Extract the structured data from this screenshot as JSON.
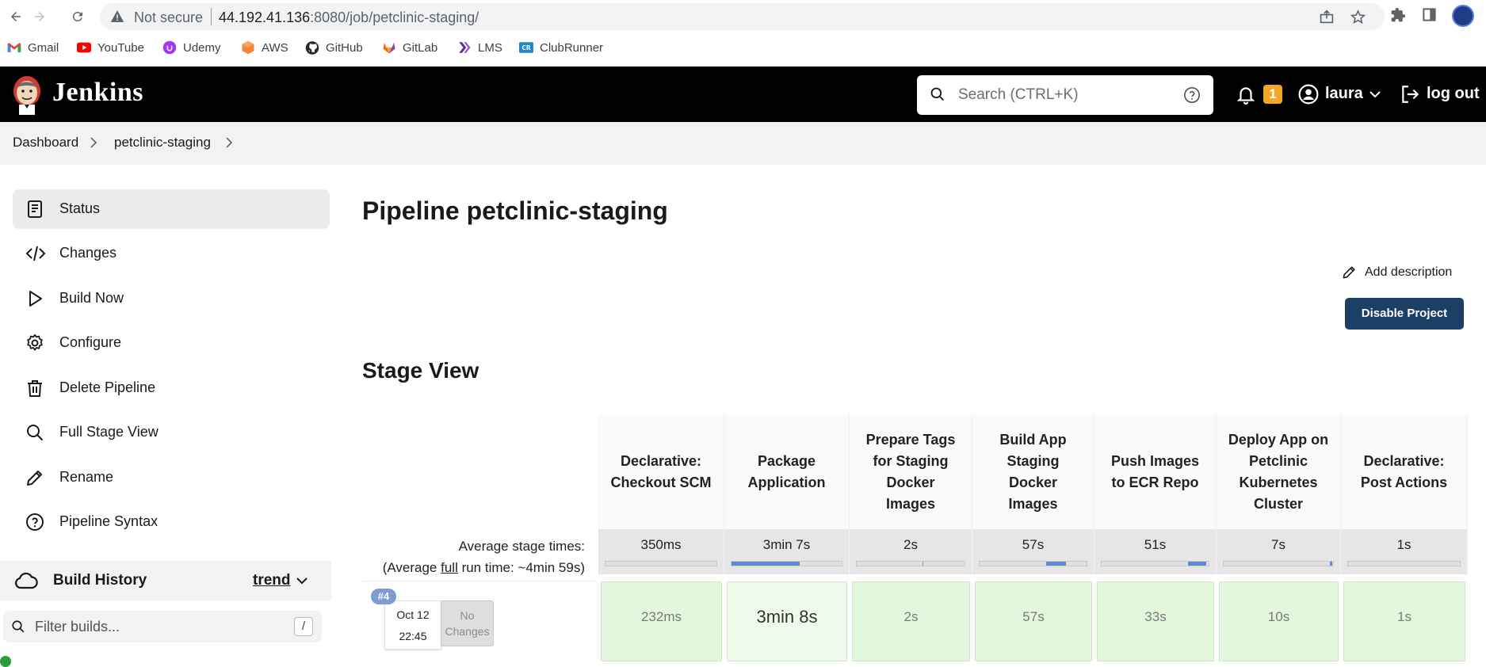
{
  "browser": {
    "security_text": "Not secure",
    "url_host": "44.192.41.136",
    "url_rest": ":8080/job/petclinic-staging/",
    "bookmarks": [
      {
        "label": "Gmail",
        "icon": "gmail-icon"
      },
      {
        "label": "YouTube",
        "icon": "youtube-icon"
      },
      {
        "label": "Udemy",
        "icon": "udemy-icon"
      },
      {
        "label": "AWS",
        "icon": "aws-icon"
      },
      {
        "label": "GitHub",
        "icon": "github-icon"
      },
      {
        "label": "GitLab",
        "icon": "gitlab-icon"
      },
      {
        "label": "LMS",
        "icon": "lms-icon"
      },
      {
        "label": "ClubRunner",
        "icon": "clubrunner-icon"
      }
    ]
  },
  "header": {
    "title": "Jenkins",
    "search_placeholder": "Search (CTRL+K)",
    "notification_count": "1",
    "user": "laura",
    "logout": "log out"
  },
  "breadcrumb": {
    "items": [
      "Dashboard",
      "petclinic-staging"
    ]
  },
  "sidebar": {
    "items": [
      {
        "label": "Status",
        "icon": "status-icon"
      },
      {
        "label": "Changes",
        "icon": "code-icon"
      },
      {
        "label": "Build Now",
        "icon": "play-icon"
      },
      {
        "label": "Configure",
        "icon": "gear-icon"
      },
      {
        "label": "Delete Pipeline",
        "icon": "trash-icon"
      },
      {
        "label": "Full Stage View",
        "icon": "search-icon"
      },
      {
        "label": "Rename",
        "icon": "pencil-icon"
      },
      {
        "label": "Pipeline Syntax",
        "icon": "help-icon"
      }
    ],
    "build_history": {
      "title": "Build History",
      "trend": "trend",
      "filter_placeholder": "Filter builds...",
      "filter_shortcut": "/"
    }
  },
  "main": {
    "title": "Pipeline petclinic-staging",
    "add_description": "Add description",
    "disable_button": "Disable Project",
    "stage_view_title": "Stage View",
    "avg_label_line1": "Average stage times:",
    "avg_label_line2_pre": "(Average ",
    "avg_label_line2_u": "full",
    "avg_label_line2_post": " run time: ~4min 59s)",
    "stages": [
      {
        "name": "Declarative: Checkout SCM",
        "avg": "350ms",
        "result": "232ms"
      },
      {
        "name": "Package Application",
        "avg": "3min 7s",
        "result": "3min 8s"
      },
      {
        "name": "Prepare Tags for Staging Docker Images",
        "avg": "2s",
        "result": "2s"
      },
      {
        "name": "Build App Staging Docker Images",
        "avg": "57s",
        "result": "57s"
      },
      {
        "name": "Push Images to ECR Repo",
        "avg": "51s",
        "result": "33s"
      },
      {
        "name": "Deploy App on Petclinic Kubernetes Cluster",
        "avg": "7s",
        "result": "10s"
      },
      {
        "name": "Declarative: Post Actions",
        "avg": "1s",
        "result": "1s"
      }
    ],
    "build": {
      "number": "#4",
      "date": "Oct 12",
      "time": "22:45",
      "changes": "No Changes"
    }
  },
  "colors": {
    "header_bg": "#000000",
    "primary_button": "#1c3f66",
    "success_cell": "#e3f7dd",
    "badge": "#f5a623"
  }
}
